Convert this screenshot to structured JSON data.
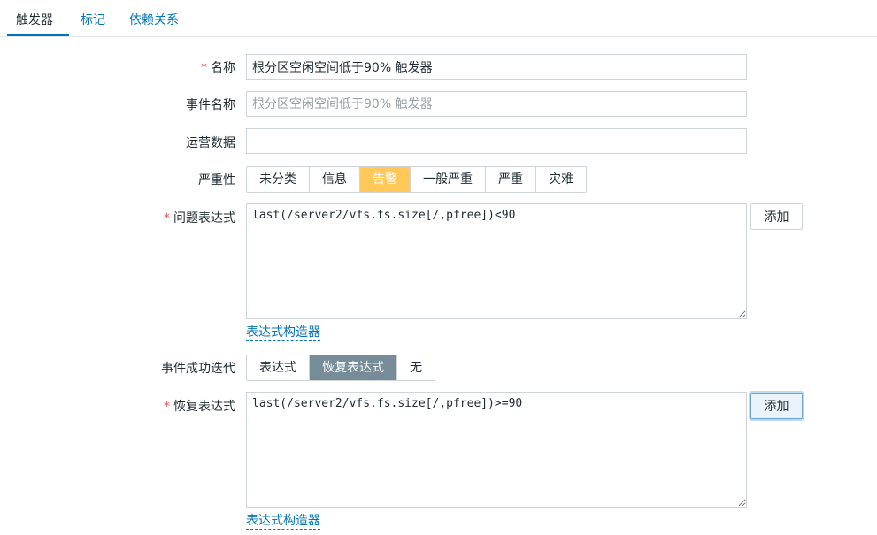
{
  "tabs": [
    {
      "label": "触发器",
      "active": true
    },
    {
      "label": "标记",
      "active": false
    },
    {
      "label": "依赖关系",
      "active": false
    }
  ],
  "form": {
    "name": {
      "label": "名称",
      "required": true,
      "value": "根分区空闲空间低于90% 触发器"
    },
    "event_name": {
      "label": "事件名称",
      "placeholder": "根分区空闲空间低于90% 触发器",
      "value": ""
    },
    "opdata": {
      "label": "运营数据",
      "value": ""
    },
    "severity": {
      "label": "严重性",
      "options": [
        "未分类",
        "信息",
        "告警",
        "一般严重",
        "严重",
        "灾难"
      ],
      "selected": "告警",
      "selected_color": "#ffc859"
    },
    "problem_expression": {
      "label": "问题表达式",
      "required": true,
      "value": "last(/server2/vfs.fs.size[/,pfree])<90",
      "add_label": "添加",
      "constructor_link": "表达式构造器"
    },
    "ok_event_generation": {
      "label": "事件成功迭代",
      "options": [
        "表达式",
        "恢复表达式",
        "无"
      ],
      "selected": "恢复表达式",
      "selected_color": "#768d99"
    },
    "recovery_expression": {
      "label": "恢复表达式",
      "required": true,
      "value": "last(/server2/vfs.fs.size[/,pfree])>=90",
      "add_label": "添加",
      "constructor_link": "表达式构造器"
    }
  },
  "colors": {
    "accent": "#0275b8",
    "required": "#e45959"
  }
}
